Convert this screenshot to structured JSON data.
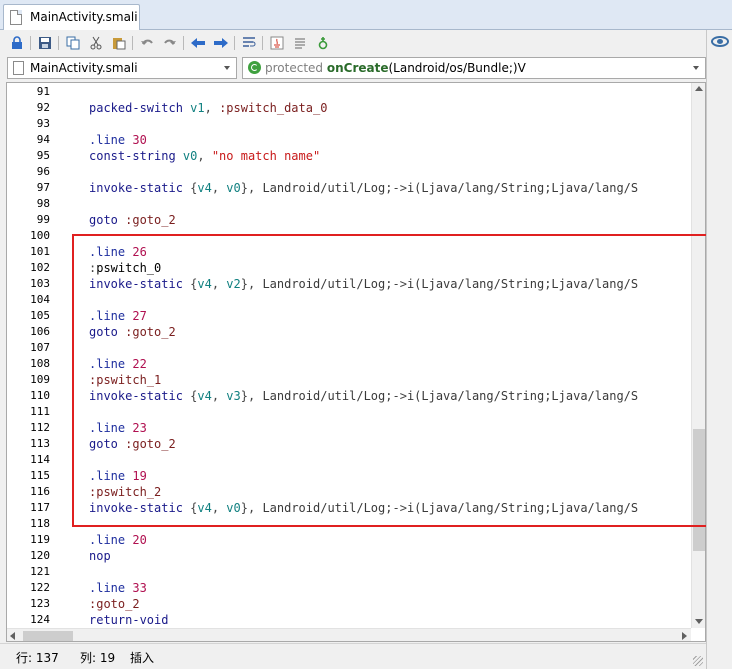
{
  "tab": {
    "title": "MainActivity.smali"
  },
  "toolbar": {
    "icons": [
      "lock-icon",
      "save-icon",
      "copy-icon",
      "cut-icon",
      "paste-icon",
      "undo-icon",
      "redo-icon",
      "back-icon",
      "forward-icon",
      "wrap-icon",
      "java-icon",
      "text-icon",
      "debug-icon"
    ]
  },
  "file_combo": {
    "value": "MainActivity.smali"
  },
  "method_combo": {
    "modifier": "protected",
    "name": "onCreate",
    "signature": "(Landroid/os/Bundle;)V"
  },
  "colors": {
    "highlight": "#fff200",
    "annotation_box": "#e02020",
    "method_icon": "#3fa13f"
  },
  "code": {
    "lines": [
      {
        "n": "91",
        "parts": []
      },
      {
        "n": "92",
        "parts": [
          [
            "ins",
            "packed-switch "
          ],
          [
            "reg",
            "v1"
          ],
          [
            "op",
            ", "
          ],
          [
            "lbl",
            ":pswitch_data_0"
          ]
        ]
      },
      {
        "n": "93",
        "parts": []
      },
      {
        "n": "94",
        "parts": [
          [
            "dir",
            ".line "
          ],
          [
            "num",
            "30"
          ]
        ]
      },
      {
        "n": "95",
        "parts": [
          [
            "ins",
            "const-string "
          ],
          [
            "reg",
            "v0"
          ],
          [
            "op",
            ", "
          ],
          [
            "str",
            "\"no match name\""
          ]
        ]
      },
      {
        "n": "96",
        "parts": []
      },
      {
        "n": "97",
        "parts": [
          [
            "ins",
            "invoke-static "
          ],
          [
            "op",
            "{"
          ],
          [
            "reg",
            "v4"
          ],
          [
            "op",
            ", "
          ],
          [
            "reg",
            "v0"
          ],
          [
            "op",
            "}, "
          ],
          [
            "cls",
            "Landroid/util/Log;"
          ],
          [
            "op",
            "->"
          ],
          [
            "cls",
            "i(Ljava/lang/String;Ljava/lang/S"
          ]
        ]
      },
      {
        "n": "98",
        "parts": []
      },
      {
        "n": "99",
        "parts": [
          [
            "ins",
            "goto "
          ],
          [
            "lbl",
            ":goto_2"
          ]
        ]
      },
      {
        "n": "100",
        "parts": []
      },
      {
        "n": "101",
        "parts": [
          [
            "dir",
            ".line "
          ],
          [
            "num",
            "26"
          ]
        ]
      },
      {
        "n": "102",
        "parts": [
          [
            "op",
            ":"
          ],
          [
            "hl",
            "pswitch_0"
          ]
        ]
      },
      {
        "n": "103",
        "parts": [
          [
            "ins",
            "invoke-static "
          ],
          [
            "op",
            "{"
          ],
          [
            "reg",
            "v4"
          ],
          [
            "op",
            ", "
          ],
          [
            "reg",
            "v2"
          ],
          [
            "op",
            "}, "
          ],
          [
            "cls",
            "Landroid/util/Log;"
          ],
          [
            "op",
            "->"
          ],
          [
            "cls",
            "i(Ljava/lang/String;Ljava/lang/S"
          ]
        ]
      },
      {
        "n": "104",
        "parts": []
      },
      {
        "n": "105",
        "parts": [
          [
            "dir",
            ".line "
          ],
          [
            "num",
            "27"
          ]
        ]
      },
      {
        "n": "106",
        "parts": [
          [
            "ins",
            "goto "
          ],
          [
            "lbl",
            ":goto_2"
          ]
        ]
      },
      {
        "n": "107",
        "parts": []
      },
      {
        "n": "108",
        "parts": [
          [
            "dir",
            ".line "
          ],
          [
            "num",
            "22"
          ]
        ]
      },
      {
        "n": "109",
        "parts": [
          [
            "lbl",
            ":pswitch_1"
          ]
        ]
      },
      {
        "n": "110",
        "parts": [
          [
            "ins",
            "invoke-static "
          ],
          [
            "op",
            "{"
          ],
          [
            "reg",
            "v4"
          ],
          [
            "op",
            ", "
          ],
          [
            "reg",
            "v3"
          ],
          [
            "op",
            "}, "
          ],
          [
            "cls",
            "Landroid/util/Log;"
          ],
          [
            "op",
            "->"
          ],
          [
            "cls",
            "i(Ljava/lang/String;Ljava/lang/S"
          ]
        ]
      },
      {
        "n": "111",
        "parts": []
      },
      {
        "n": "112",
        "parts": [
          [
            "dir",
            ".line "
          ],
          [
            "num",
            "23"
          ]
        ]
      },
      {
        "n": "113",
        "parts": [
          [
            "ins",
            "goto "
          ],
          [
            "lbl",
            ":goto_2"
          ]
        ]
      },
      {
        "n": "114",
        "parts": []
      },
      {
        "n": "115",
        "parts": [
          [
            "dir",
            ".line "
          ],
          [
            "num",
            "19"
          ]
        ]
      },
      {
        "n": "116",
        "parts": [
          [
            "lbl",
            ":pswitch_2"
          ]
        ]
      },
      {
        "n": "117",
        "parts": [
          [
            "ins",
            "invoke-static "
          ],
          [
            "op",
            "{"
          ],
          [
            "reg",
            "v4"
          ],
          [
            "op",
            ", "
          ],
          [
            "reg",
            "v0"
          ],
          [
            "op",
            "}, "
          ],
          [
            "cls",
            "Landroid/util/Log;"
          ],
          [
            "op",
            "->"
          ],
          [
            "cls",
            "i(Ljava/lang/String;Ljava/lang/S"
          ]
        ]
      },
      {
        "n": "118",
        "parts": []
      },
      {
        "n": "119",
        "parts": [
          [
            "dir",
            ".line "
          ],
          [
            "num",
            "20"
          ]
        ]
      },
      {
        "n": "120",
        "parts": [
          [
            "ins",
            "nop"
          ]
        ]
      },
      {
        "n": "121",
        "parts": []
      },
      {
        "n": "122",
        "parts": [
          [
            "dir",
            ".line "
          ],
          [
            "num",
            "33"
          ]
        ]
      },
      {
        "n": "123",
        "parts": [
          [
            "lbl",
            ":goto_2"
          ]
        ]
      },
      {
        "n": "124",
        "parts": [
          [
            "ins",
            "return-void"
          ]
        ]
      }
    ]
  },
  "status": {
    "row_label": "行: 137",
    "col_label": "列: 19",
    "mode_label": "插入"
  }
}
